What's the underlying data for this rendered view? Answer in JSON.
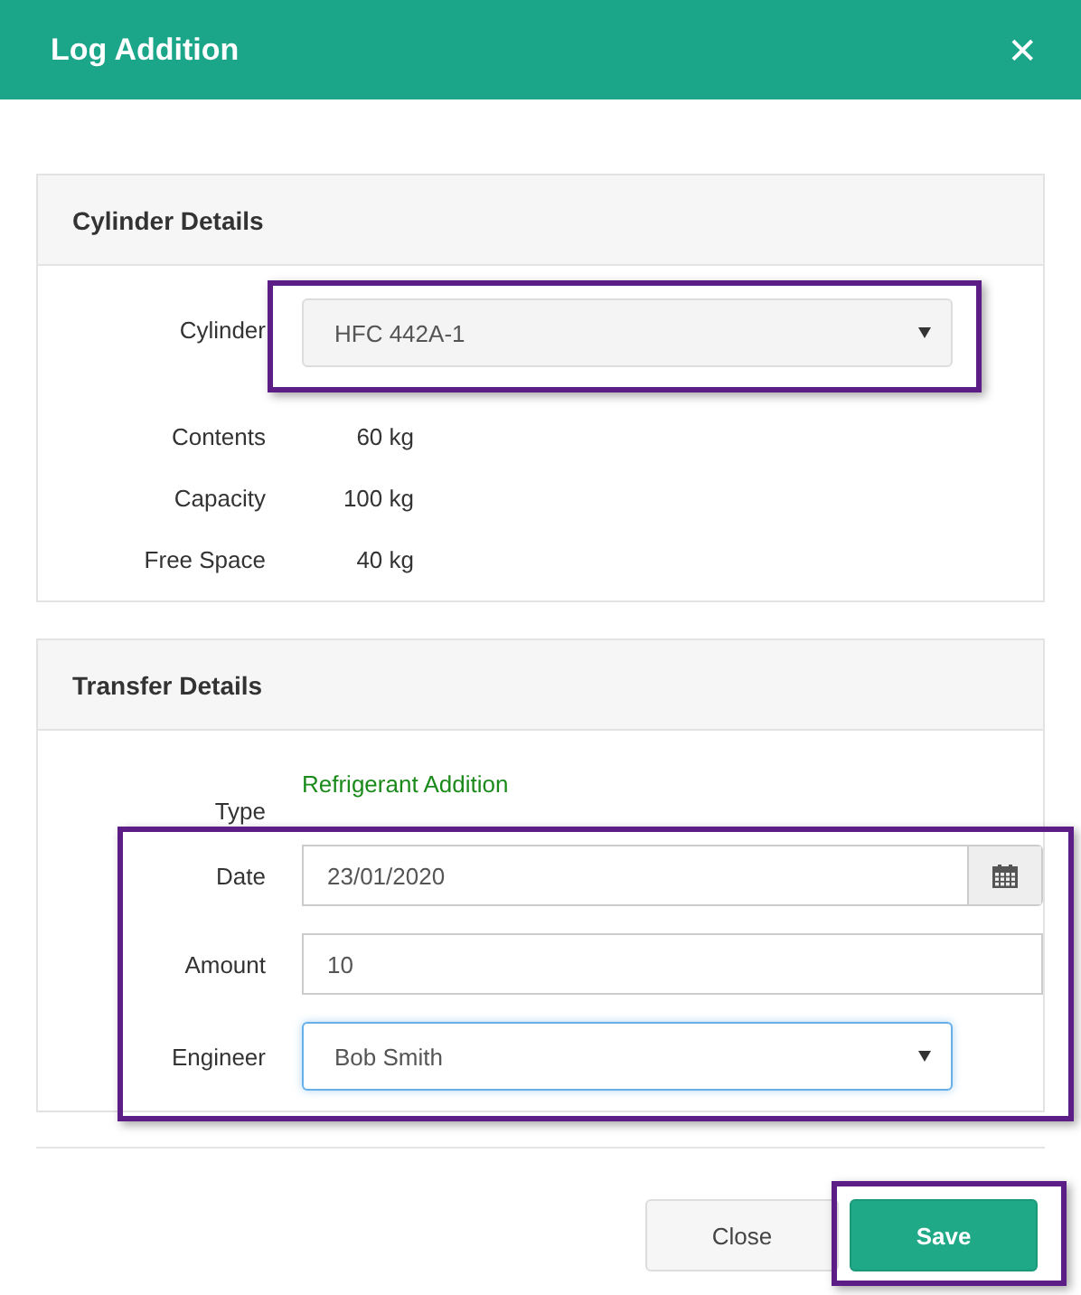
{
  "window": {
    "title": "Log Addition",
    "close_icon": "✕"
  },
  "cylinder_panel": {
    "title": "Cylinder Details",
    "cylinder": {
      "label": "Cylinder",
      "value": "HFC 442A-1",
      "highlighted": true
    },
    "details": [
      {
        "label": "Contents",
        "value": "60 kg"
      },
      {
        "label": "Capacity",
        "value": "100 kg"
      },
      {
        "label": "Free Space",
        "value": "40 kg"
      }
    ]
  },
  "transfer_panel": {
    "title": "Transfer Details",
    "type": {
      "label": "Type",
      "value": "Refrigerant Addition"
    },
    "fields_highlighted": true,
    "fields": [
      {
        "kind": "date",
        "label": "Date",
        "value": "23/01/2020",
        "focused": false
      },
      {
        "kind": "text",
        "label": "Amount",
        "value": "10",
        "focused": false
      },
      {
        "kind": "select",
        "label": "Engineer",
        "value": "Bob Smith",
        "focused": true
      }
    ]
  },
  "buttons": [
    {
      "kind": "secondary",
      "label": "Close",
      "highlighted": false
    },
    {
      "kind": "primary",
      "label": "Save",
      "highlighted": true
    }
  ]
}
